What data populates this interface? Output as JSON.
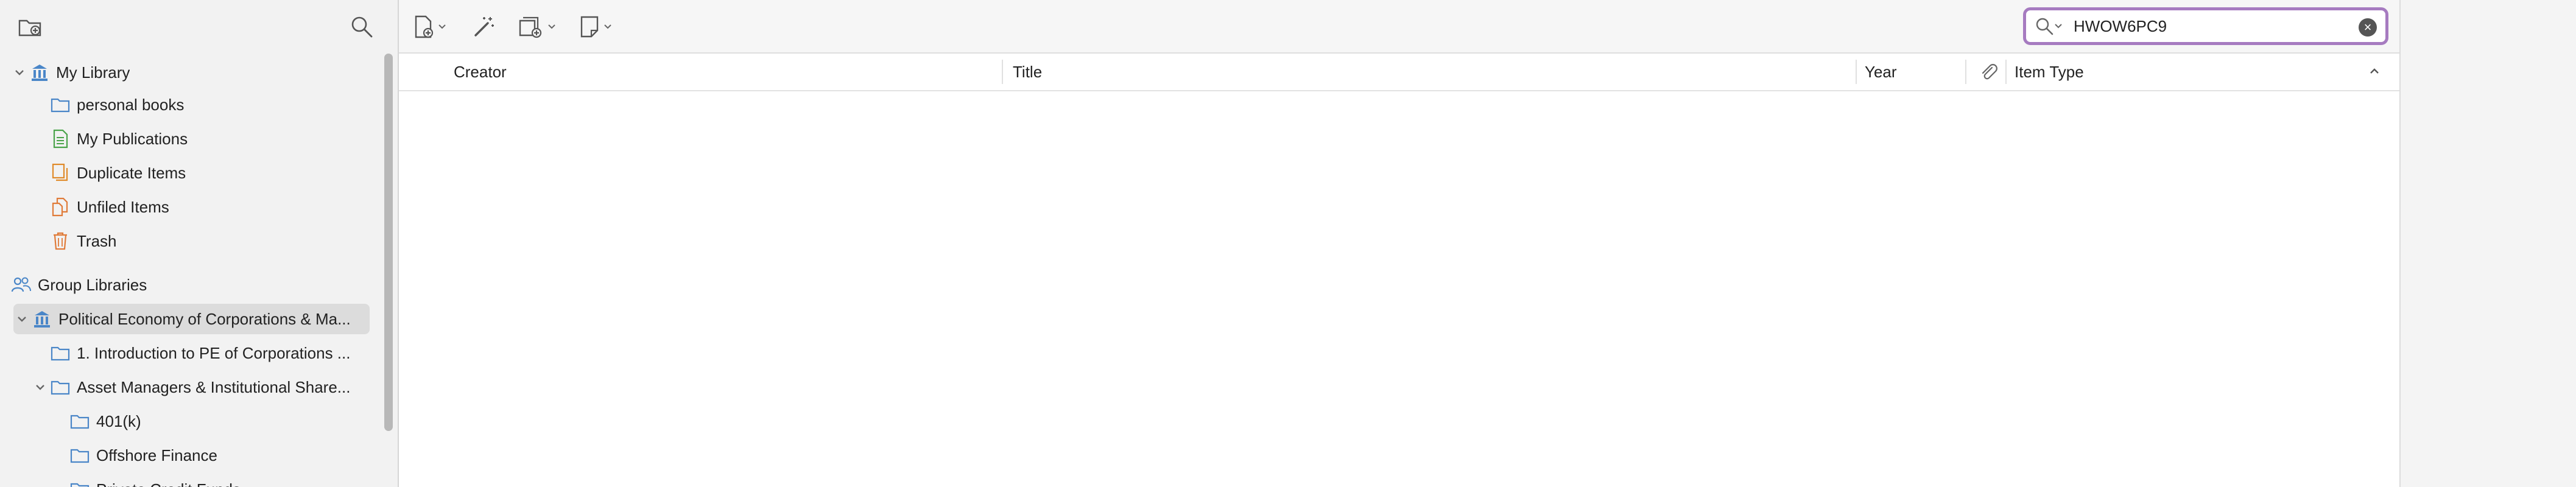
{
  "sidebar": {
    "new_collection_icon": "folder-plus-icon",
    "search_icon": "magnifier-icon",
    "my_library": {
      "label": "My Library",
      "children": [
        {
          "label": "personal books",
          "icon": "folder-icon"
        },
        {
          "label": "My Publications",
          "icon": "document-icon"
        },
        {
          "label": "Duplicate Items",
          "icon": "duplicate-icon"
        },
        {
          "label": "Unfiled Items",
          "icon": "unfiled-icon"
        },
        {
          "label": "Trash",
          "icon": "trash-icon"
        }
      ]
    },
    "group_libraries_label": "Group Libraries",
    "group": {
      "label": "Political Economy of Corporations & Ma...",
      "children": [
        {
          "label": "1. Introduction to PE of Corporations ...",
          "icon": "folder-icon"
        },
        {
          "label": "Asset Managers & Institutional Share...",
          "icon": "folder-icon",
          "expanded": true,
          "children": [
            {
              "label": "401(k)",
              "icon": "folder-icon"
            },
            {
              "label": "Offshore Finance",
              "icon": "folder-icon"
            },
            {
              "label": "Private Credit Funds",
              "icon": "folder-icon"
            }
          ]
        }
      ]
    }
  },
  "toolbar": {
    "new_item_icon": "new-item-icon",
    "magic_wand_icon": "magic-wand-icon",
    "add_attachment_icon": "add-attachment-icon",
    "new_note_icon": "new-note-icon"
  },
  "search": {
    "value": "HWOW6PC9",
    "clear_icon": "clear-icon"
  },
  "columns": {
    "creator": "Creator",
    "title": "Title",
    "year": "Year",
    "attachments_icon": "paperclip-icon",
    "item_type": "Item Type"
  },
  "colors": {
    "accent_focus": "#a67bc0",
    "library_blue": "#4a86c8",
    "folder_blue": "#4a86c8",
    "publications_green": "#4aa34a",
    "orange": "#e07b39"
  }
}
